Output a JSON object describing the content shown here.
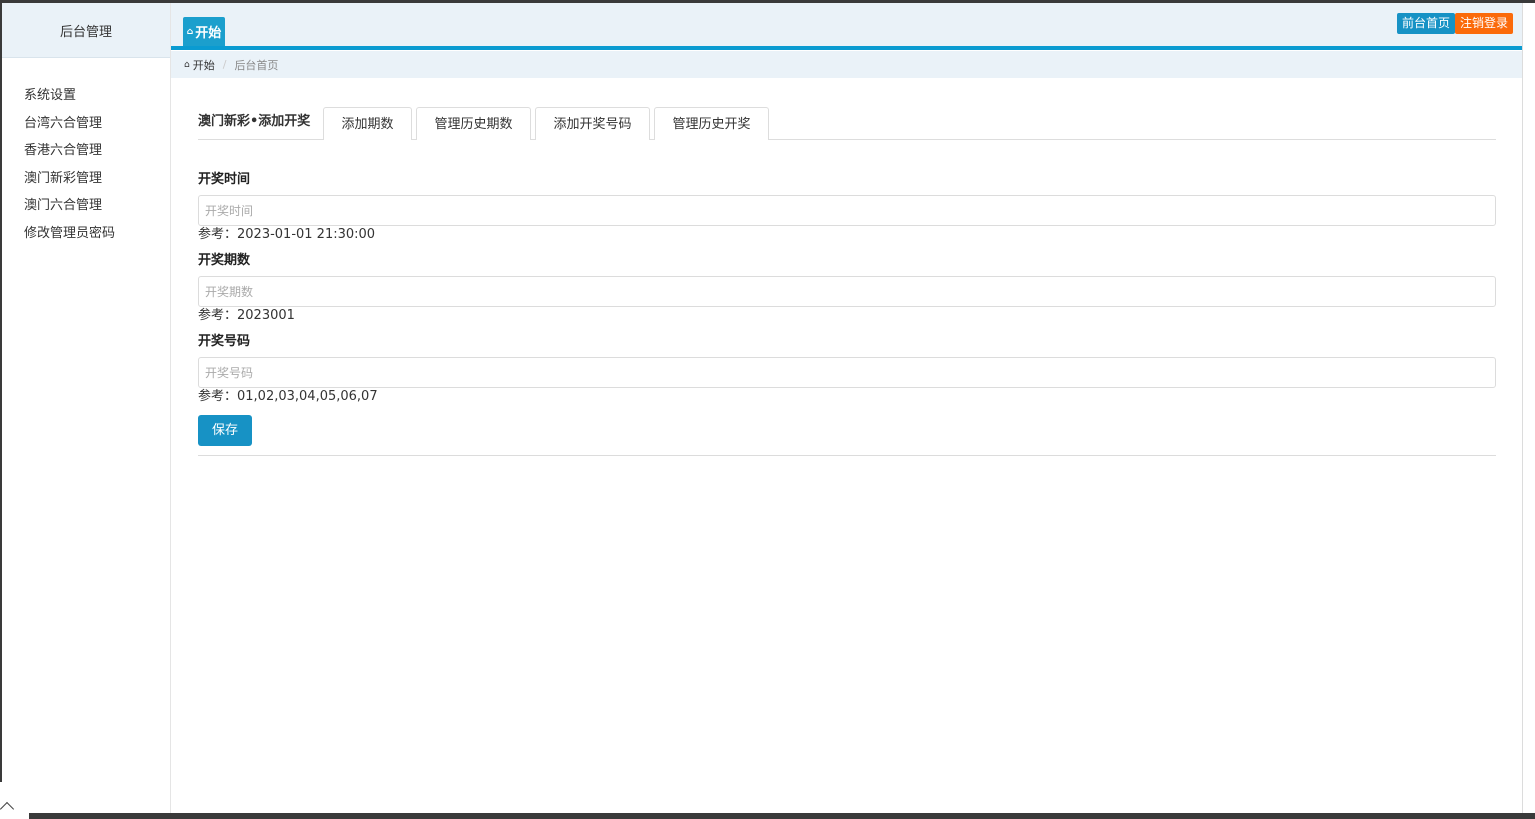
{
  "sidebar": {
    "brand": "后台管理",
    "items": [
      {
        "label": "系统设置"
      },
      {
        "label": "台湾六合管理"
      },
      {
        "label": "香港六合管理"
      },
      {
        "label": "澳门新彩管理"
      },
      {
        "label": "澳门六合管理"
      },
      {
        "label": "修改管理员密码"
      }
    ]
  },
  "topbar": {
    "tab_label": "开始",
    "tab_icon": "home-icon",
    "front_button": "前台首页",
    "logout_button": "注销登录"
  },
  "breadcrumb": {
    "first": "开始",
    "current": "后台首页",
    "icon": "home-icon"
  },
  "tabs": {
    "heading": "澳门新彩•添加开奖",
    "items": [
      {
        "label": "添加期数"
      },
      {
        "label": "管理历史期数"
      },
      {
        "label": "添加开奖号码"
      },
      {
        "label": "管理历史开奖"
      }
    ]
  },
  "form": {
    "fields": [
      {
        "label": "开奖时间",
        "placeholder": "开奖时间",
        "value": "",
        "hint": "参考：2023-01-01 21:30:00"
      },
      {
        "label": "开奖期数",
        "placeholder": "开奖期数",
        "value": "",
        "hint": "参考：2023001"
      },
      {
        "label": "开奖号码",
        "placeholder": "开奖号码",
        "value": "",
        "hint": "参考：01,02,03,04,05,06,07"
      }
    ],
    "save_label": "保存"
  },
  "colors": {
    "accent": "#1792c5",
    "header_bg": "#eaf2f8",
    "header_border": "#0a9bd1",
    "logout": "#fb6a0a"
  }
}
